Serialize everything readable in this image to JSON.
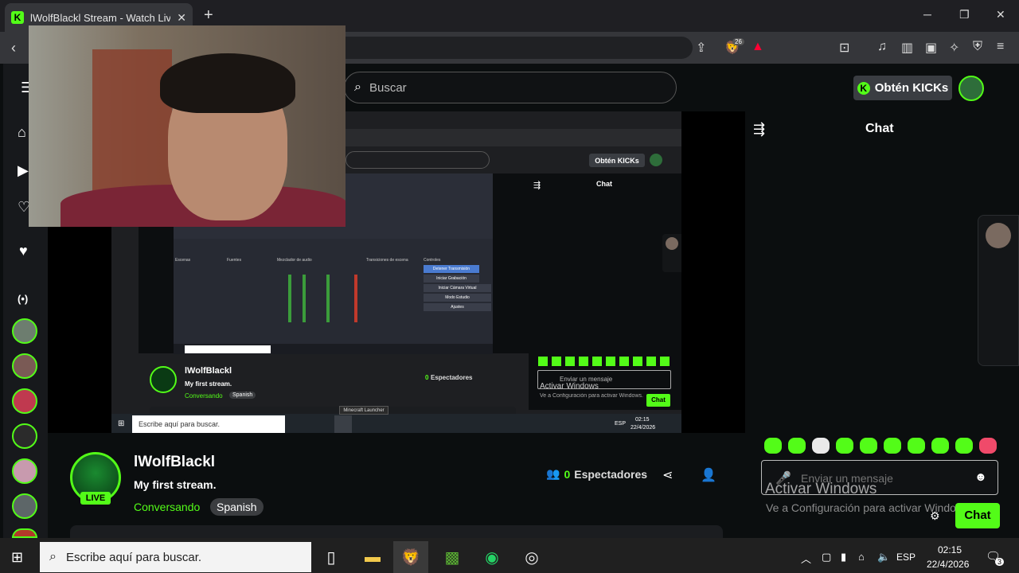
{
  "browser": {
    "tab_title": "lWolfBlackl Stream - Watch Live on Kick",
    "favicon": "K",
    "new_tab": "+",
    "controls": {
      "minimize": "─",
      "maximize": "❐",
      "close": "✕"
    },
    "brave_badge": "26"
  },
  "header": {
    "search_placeholder": "Buscar",
    "kicks_button": "Obtén KICKs"
  },
  "stream": {
    "streamer_name": "lWolfBlackl",
    "live_badge": "LIVE",
    "title": "My first stream.",
    "category": "Conversando",
    "language": "Spanish",
    "viewers_count": "0",
    "viewers_label": "Espectadores"
  },
  "nested": {
    "kicks_button": "Obtén KICKs",
    "chat_title": "Chat",
    "streamer_name": "lWolfBlackl",
    "title": "My first stream.",
    "category": "Conversando",
    "language": "Spanish",
    "viewers_count": "0",
    "viewers_label": "Espectadores",
    "chat_placeholder": "Enviar un mensaje",
    "chat_send": "Chat",
    "activate_title": "Activar Windows",
    "activate_sub": "Ve a Configuración para activar Windows.",
    "taskbar_search": "Escribe aquí para buscar.",
    "tooltip": "Minecraft Launcher",
    "lang": "ESP",
    "time": "02:15",
    "date": "22/4/2026",
    "obs_headers": [
      "Escenas",
      "Fuentes",
      "Mezclador de audio",
      "Transiciones de escena",
      "Controles"
    ],
    "obs_controls": [
      "Detener Transmisión",
      "Iniciar Grabación",
      "Iniciar Cámara Virtual",
      "Modo Estudio",
      "Ajustes"
    ]
  },
  "chat": {
    "title": "Chat",
    "placeholder": "Enviar un mensaje",
    "send_label": "Chat"
  },
  "watermark": {
    "title": "Activar Windows",
    "subtitle": "Ve a Configuración para activar Windows."
  },
  "taskbar": {
    "search_placeholder": "Escribe aquí para buscar.",
    "lang": "ESP",
    "time": "02:15",
    "date": "22/4/2026",
    "notification_count": "3"
  },
  "colors": {
    "accent": "#53fc18",
    "background": "#0b0e0f"
  }
}
